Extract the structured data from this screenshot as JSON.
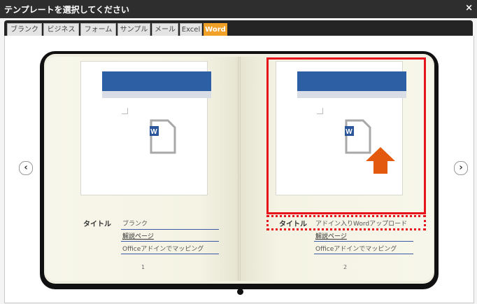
{
  "window": {
    "title": "テンプレートを選択してください",
    "close_label": "×"
  },
  "tabs": [
    {
      "label": "ブランク",
      "active": false
    },
    {
      "label": "ビジネス",
      "active": false
    },
    {
      "label": "フォーム",
      "active": false
    },
    {
      "label": "サンプル",
      "active": false
    },
    {
      "label": "メール",
      "active": false
    },
    {
      "label": "Excel",
      "active": false
    },
    {
      "label": "Word",
      "active": true
    }
  ],
  "nav": {
    "prev_label": "‹",
    "next_label": "›"
  },
  "templates": [
    {
      "title_label": "タイトル",
      "title_value": "ブランク",
      "link": "解説ページ",
      "description": "Officeアドインでマッピング",
      "page_number": "1",
      "doc_icon_letter": "W",
      "has_upload_arrow": false
    },
    {
      "title_label": "タイトル",
      "title_value": "アドイン入りWordアップロード",
      "link": "解説ページ",
      "description": "Officeアドインでマッピング",
      "page_number": "2",
      "doc_icon_letter": "W",
      "has_upload_arrow": true
    }
  ],
  "colors": {
    "accent": "#f1a028",
    "highlight": "#e8141b",
    "header_band": "#2d5fa5",
    "word_blue": "#2b579a",
    "upload_arrow": "#e35a0e"
  }
}
